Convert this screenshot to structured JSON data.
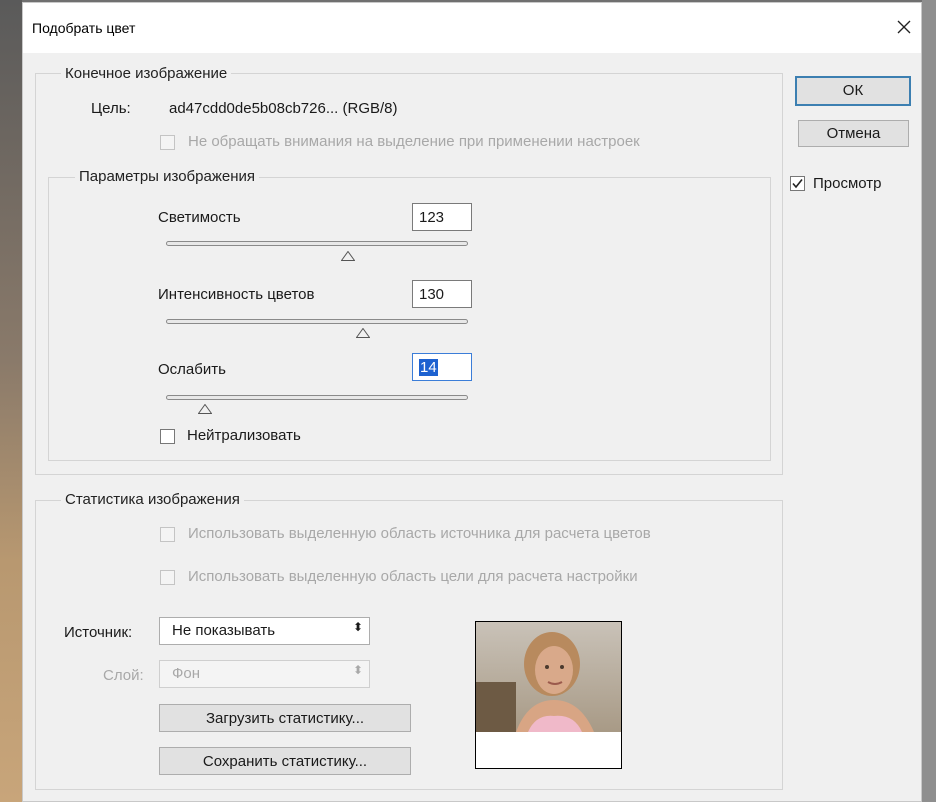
{
  "window": {
    "title": "Подобрать цвет"
  },
  "destination_group": {
    "legend": "Конечное изображение",
    "target_label": "Цель:",
    "target_value": "ad47cdd0de5b08cb726... (RGB/8)",
    "ignore_selection_label": "Не обращать внимания на выделение при применении настроек"
  },
  "image_options": {
    "legend": "Параметры изображения",
    "luminance_label": "Светимость",
    "luminance_value": "123",
    "luminance_level": 0.5,
    "color_intensity_label": "Интенсивность цветов",
    "color_intensity_value": "130",
    "color_intensity_level": 0.65,
    "fade_label": "Ослабить",
    "fade_value": "14",
    "fade_level": 0.14,
    "neutralize_label": "Нейтрализовать"
  },
  "buttons": {
    "ok_label": "ОК",
    "cancel_label": "Отмена",
    "preview_label": "Просмотр"
  },
  "image_statistics": {
    "legend": "Статистика изображения",
    "use_source_selection_label": "Использовать выделенную область источника для расчета цветов",
    "use_target_selection_label": "Использовать выделенную область цели для расчета настройки",
    "source_label": "Источник:",
    "source_value": "Не показывать",
    "layer_label": "Слой:",
    "layer_value": "Фон",
    "load_stats_label": "Загрузить статистику...",
    "save_stats_label": "Сохранить статистику..."
  },
  "colors": {
    "accent": "#3c7fb1",
    "selection": "#1e62d0"
  }
}
